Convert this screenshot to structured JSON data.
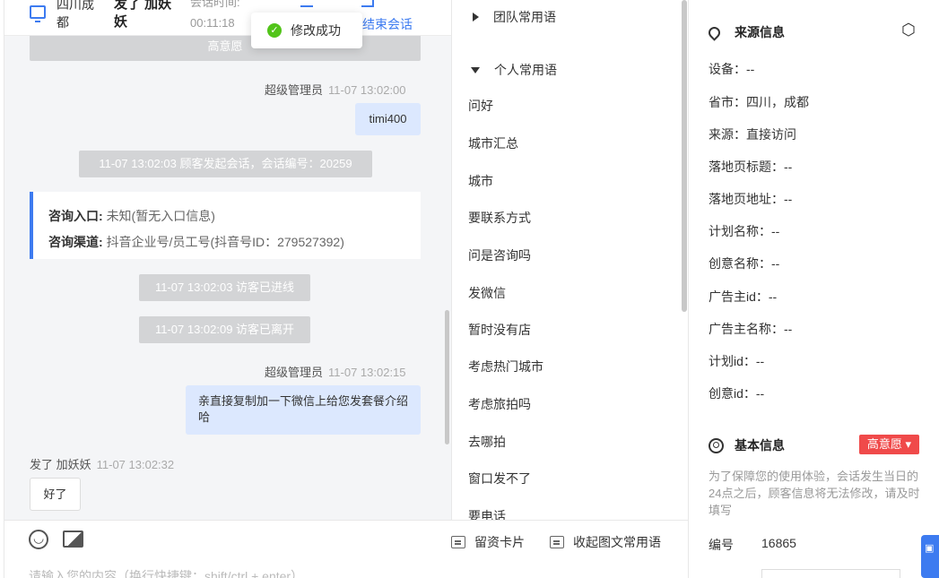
{
  "header": {
    "location": "四川成都",
    "visitor_name": "发了 加妖妖",
    "session_time_label": "会话时间:",
    "session_time": "00:11:18",
    "end_session": "结束会话"
  },
  "toast": {
    "text": "修改成功"
  },
  "chat": {
    "top_notice": "高意愿",
    "messages": [
      {
        "sender": "超级管理员",
        "time": "11-07 13:02:00",
        "text": "timi400"
      },
      {
        "sender": "超级管理员",
        "time": "11-07 13:02:15",
        "text": "亲直接复制加一下微信上给您发套餐介绍哈"
      },
      {
        "sender": "发了 加妖妖",
        "time": "11-07 13:02:32",
        "text": "好了"
      }
    ],
    "system_start": "11-07 13:02:03 顾客发起会话，会话编号：20259",
    "system_enter": "11-07 13:02:03 访客已进线",
    "system_leave": "11-07 13:02:09 访客已离开",
    "entry_label": "咨询入口:",
    "entry_value": "未知(暂无入口信息)",
    "channel_label": "咨询渠道:",
    "channel_value": "抖音企业号/员工号(抖音号ID：279527392)"
  },
  "composer": {
    "card_button": "留资卡片",
    "collapse_button": "收起图文常用语",
    "placeholder": "请输入您的内容（换行快捷键：shift/ctrl + enter）"
  },
  "phrases": {
    "team_group": "团队常用语",
    "personal_group": "个人常用语",
    "items": [
      "问好",
      "城市汇总",
      "城市",
      "要联系方式",
      "问是咨询吗",
      "发微信",
      "暂时没有店",
      "考虑热门城市",
      "考虑旅拍吗",
      "去哪拍",
      "窗口发不了",
      "要电话"
    ]
  },
  "source_info": {
    "title": "来源信息",
    "fields": [
      "设备：--",
      "省市：四川，成都",
      "来源：直接访问",
      "落地页标题：--",
      "落地页地址：--",
      "计划名称：--",
      "创意名称：--",
      "广告主id：--",
      "广告主名称：--",
      "计划id：--",
      "创意id：--"
    ]
  },
  "basic_info": {
    "title": "基本信息",
    "intent_badge": "高意愿",
    "note": "为了保障您的使用体验，会话发生当日的24点之后，顾客信息将无法修改，请及时填写",
    "id_label": "编号",
    "id_value": "16865"
  },
  "colors": {
    "accent": "#3d7bf0",
    "badge": "#f04a4a",
    "success": "#52c41a"
  }
}
